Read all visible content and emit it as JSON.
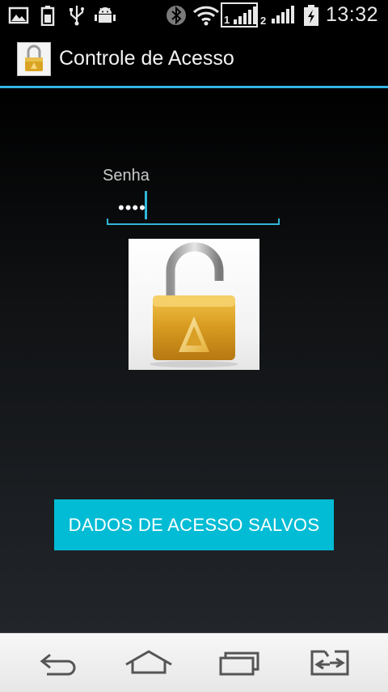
{
  "status_bar": {
    "time": "13:32",
    "sim1_label": "1",
    "sim2_label": "2",
    "icons": [
      "image-icon",
      "battery-small-icon",
      "usb-icon",
      "android-debug-icon",
      "bluetooth-icon",
      "wifi-icon",
      "signal-sim1-icon",
      "signal-sim2-icon",
      "battery-charging-icon"
    ]
  },
  "action_bar": {
    "title": "Controle de Acesso",
    "app_icon": "padlock-icon"
  },
  "form": {
    "password_label": "Senha",
    "password_mask": "••••"
  },
  "lock_image": {
    "icon": "open-padlock",
    "state": "unlocked"
  },
  "saved_button": {
    "label": "DADOS DE ACESSO SALVOS",
    "color": "#01bcd4"
  },
  "nav_bar": {
    "buttons": [
      "back-icon",
      "home-icon",
      "recent-apps-icon",
      "dual-window-icon"
    ]
  },
  "colors": {
    "accent": "#33b5e5",
    "button": "#01bcd4"
  }
}
